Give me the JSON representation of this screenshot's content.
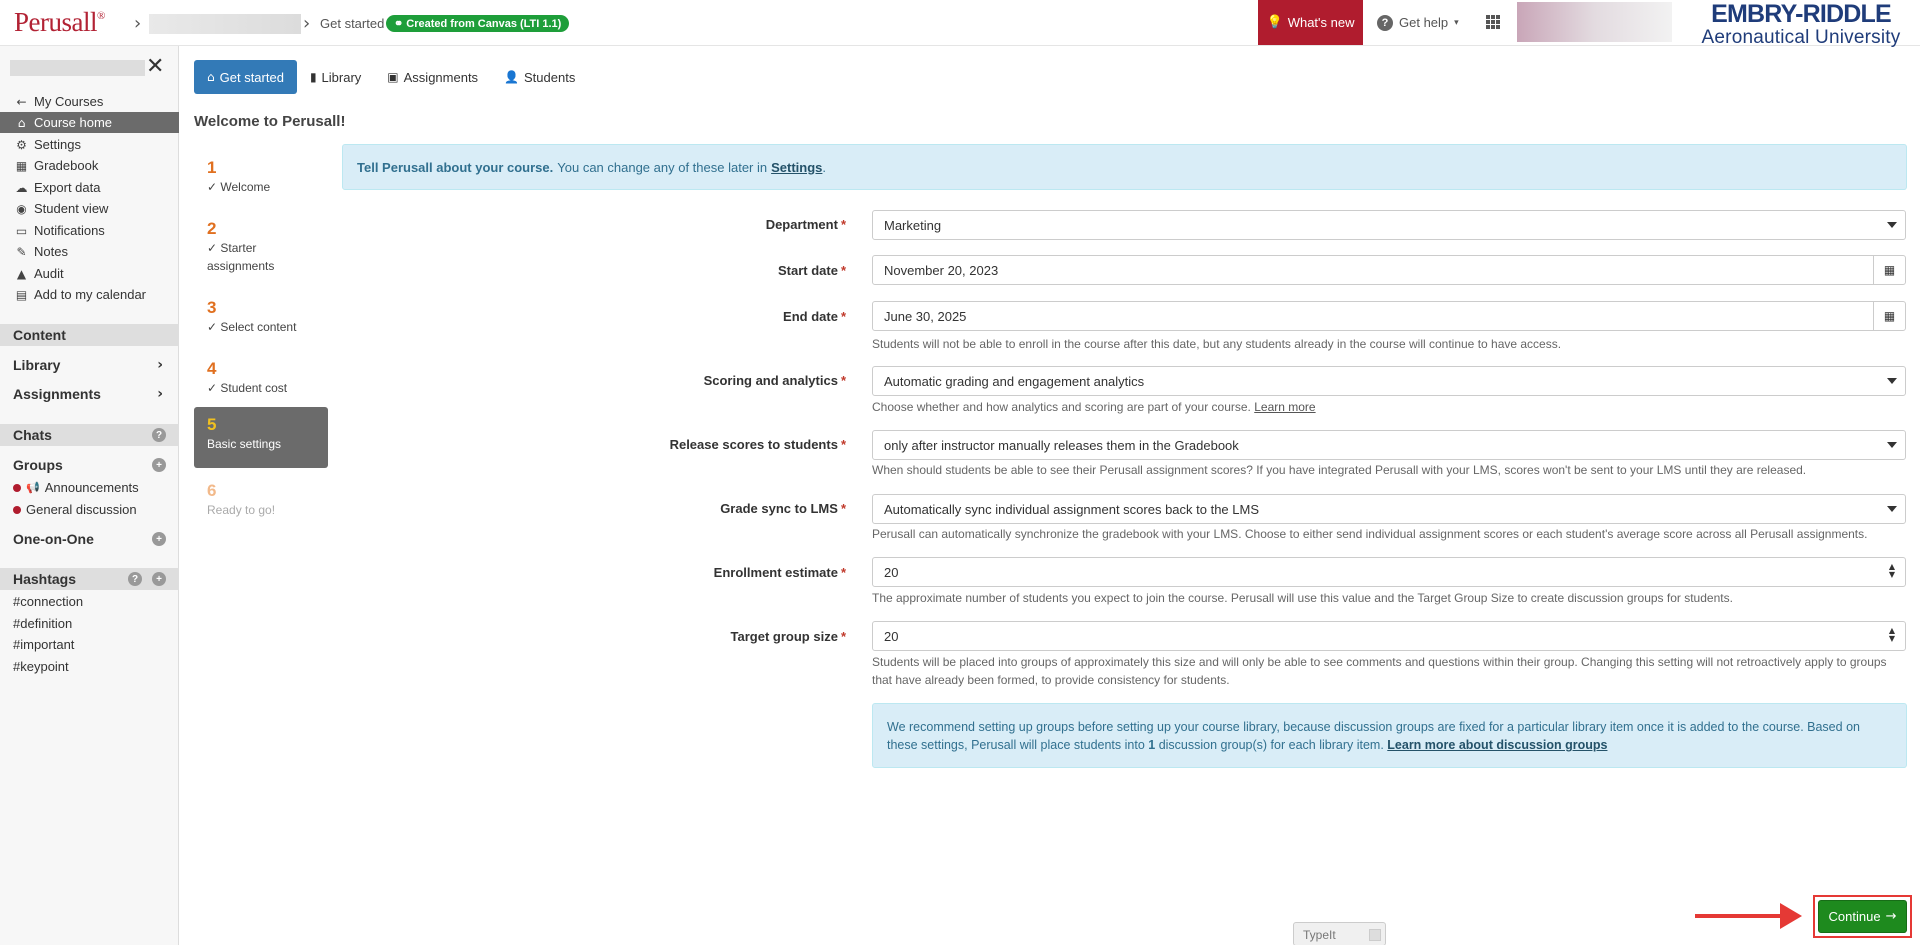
{
  "topbar": {
    "logo": "Perusall",
    "logo_mark": "®",
    "breadcrumb_current": "Get started",
    "lti_badge": "Created from Canvas (LTI 1.1)",
    "whats_new": "What's new",
    "get_help": "Get help",
    "institution_line1": "EMBRY-RIDDLE",
    "institution_line2": "Aeronautical University",
    "accent_color": "#b01c2e"
  },
  "sidebar": {
    "nav": [
      {
        "label": "My Courses",
        "icon": "arrow-left-icon"
      },
      {
        "label": "Course home",
        "icon": "home-icon"
      },
      {
        "label": "Settings",
        "icon": "gear-icon"
      },
      {
        "label": "Gradebook",
        "icon": "table-icon"
      },
      {
        "label": "Export data",
        "icon": "cloud-download-icon"
      },
      {
        "label": "Student view",
        "icon": "eye-icon"
      },
      {
        "label": "Notifications",
        "icon": "inbox-icon"
      },
      {
        "label": "Notes",
        "icon": "pencil-icon"
      },
      {
        "label": "Audit",
        "icon": "warning-icon"
      },
      {
        "label": "Add to my calendar",
        "icon": "calendar-icon"
      }
    ],
    "content_header": "Content",
    "library": "Library",
    "assignments": "Assignments",
    "chats_header": "Chats",
    "groups_label": "Groups",
    "announcements": "Announcements",
    "general_discussion": "General discussion",
    "one_on_one": "One-on-One",
    "hashtags_header": "Hashtags",
    "hashtags": [
      "#connection",
      "#definition",
      "#important",
      "#keypoint"
    ]
  },
  "tabs": [
    {
      "label": "Get started",
      "icon": "home-icon"
    },
    {
      "label": "Library",
      "icon": "book-icon"
    },
    {
      "label": "Assignments",
      "icon": "calendar-check-icon"
    },
    {
      "label": "Students",
      "icon": "user-icon"
    }
  ],
  "page_title": "Welcome to Perusall!",
  "steps": [
    {
      "num": "1",
      "label": "Welcome",
      "done": true
    },
    {
      "num": "2",
      "label": "Starter assignments",
      "done": true
    },
    {
      "num": "3",
      "label": "Select content",
      "done": true
    },
    {
      "num": "4",
      "label": "Student cost",
      "done": true
    },
    {
      "num": "5",
      "label": "Basic settings",
      "done": false
    },
    {
      "num": "6",
      "label": "Ready to go!",
      "done": false
    }
  ],
  "info": {
    "bold": "Tell Perusall about your course.",
    "text": "You can change any of these later in",
    "link": "Settings",
    "end": "."
  },
  "form": {
    "department": {
      "label": "Department",
      "value": "Marketing"
    },
    "start_date": {
      "label": "Start date",
      "value": "November 20, 2023"
    },
    "end_date": {
      "label": "End date",
      "value": "June 30, 2025",
      "help": "Students will not be able to enroll in the course after this date, but any students already in the course will continue to have access."
    },
    "scoring": {
      "label": "Scoring and analytics",
      "value": "Automatic grading and engagement analytics",
      "help": "Choose whether and how analytics and scoring are part of your course.",
      "help_link": "Learn more"
    },
    "release": {
      "label": "Release scores to students",
      "value": "only after instructor manually releases them in the Gradebook",
      "help": "When should students be able to see their Perusall assignment scores? If you have integrated Perusall with your LMS, scores won't be sent to your LMS until they are released."
    },
    "grade_sync": {
      "label": "Grade sync to LMS",
      "value": "Automatically sync individual assignment scores back to the LMS",
      "help": "Perusall can automatically synchronize the gradebook with your LMS. Choose to either send individual assignment scores or each student's average score across all Perusall assignments."
    },
    "enrollment": {
      "label": "Enrollment estimate",
      "value": "20",
      "help": "The approximate number of students you expect to join the course. Perusall will use this value and the Target Group Size to create discussion groups for students."
    },
    "group_size": {
      "label": "Target group size",
      "value": "20",
      "help": "Students will be placed into groups of approximately this size and will only be able to see comments and questions within their group. Changing this setting will not retroactively apply to groups that have already been formed, to provide consistency for students."
    }
  },
  "recommend": {
    "text1": "We recommend setting up groups before setting up your course library, because discussion groups are fixed for a particular library item once it is added to the course. Based on these settings, Perusall will place students into",
    "count": "1",
    "text2": "discussion group(s) for each library item.",
    "link": "Learn more about discussion groups"
  },
  "typeit": "TypeIt",
  "continue_button": "Continue",
  "continue_color": "#1e8a1e"
}
